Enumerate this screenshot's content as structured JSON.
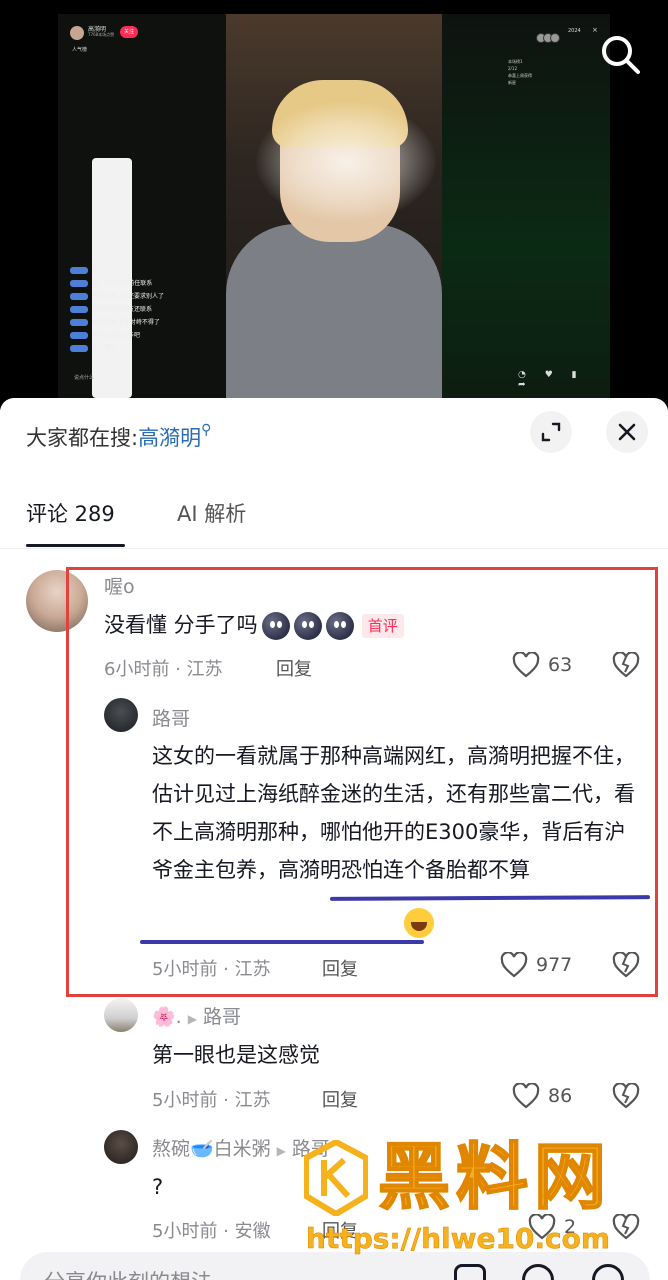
{
  "video": {
    "host_name": "高漪明",
    "host_sub": "7768本场点赞",
    "follow_label": "关注",
    "rank_label": "人气榜",
    "viewer_count": "2024",
    "close_glyph": "×",
    "stat_lines": [
      "本场榜1",
      "2/12",
      "恭喜上周获得",
      "新星"
    ],
    "chat_lines": [
      {
        "level": "34",
        "text": "了？"
      },
      {
        "level": "13",
        "text": "🐱：他说你跟前任联系"
      },
      {
        "level": "13",
        "text": "把都乱搞，你还要求别人了"
      },
      {
        "level": "13",
        "text": "说你跟你前女友还联系"
      },
      {
        "level": "12",
        "text": "俩都开播 连麦对峙不得了"
      },
      {
        "level": "6",
        "text": "城市还是机会多吧"
      },
      {
        "level": "12",
        "text": "了点赞了"
      }
    ],
    "chat_bottom": "说点什么"
  },
  "sheet": {
    "hot_search_prefix": "大家都在搜:",
    "hot_search_term": "高漪明",
    "tabs": [
      {
        "label": "评论 289",
        "active": true
      },
      {
        "label": "AI 解析",
        "active": false
      }
    ]
  },
  "comments": [
    {
      "username": "喔o",
      "text": "没看懂 分手了吗",
      "badge": "首评",
      "time_location": "6小时前 · 江苏",
      "reply_label": "回复",
      "likes": "63"
    },
    {
      "username": "路哥",
      "text": "这女的一看就属于那种高端网红，高漪明把握不住，估计见过上海纸醉金迷的生活，还有那些富二代，看不上高漪明那种，哪怕他开的E300豪华，背后有沪爷金主包养，高漪明恐怕连个备胎都不算",
      "time_location": "5小时前 · 江苏",
      "reply_label": "回复",
      "likes": "977"
    },
    {
      "username": "🌸.",
      "reply_to": "路哥",
      "text": "第一眼也是这感觉",
      "time_location": "5小时前 · 江苏",
      "reply_label": "回复",
      "likes": "86"
    },
    {
      "username": "熬碗🥣白米粥",
      "reply_to": "路哥",
      "text": "?",
      "time_location": "5小时前 · 安徽",
      "reply_label": "回复",
      "likes": "2"
    }
  ],
  "watermark": {
    "title": "黑料网",
    "url": "https://hlwe10.com"
  },
  "input": {
    "placeholder": "分享你此刻的想法"
  },
  "colors": {
    "accent_red": "#fe2c55",
    "link_blue": "#2a6cb4",
    "highlight_box": "#e0433c",
    "underline": "#3b3aa8",
    "watermark": "#f5b21c"
  }
}
